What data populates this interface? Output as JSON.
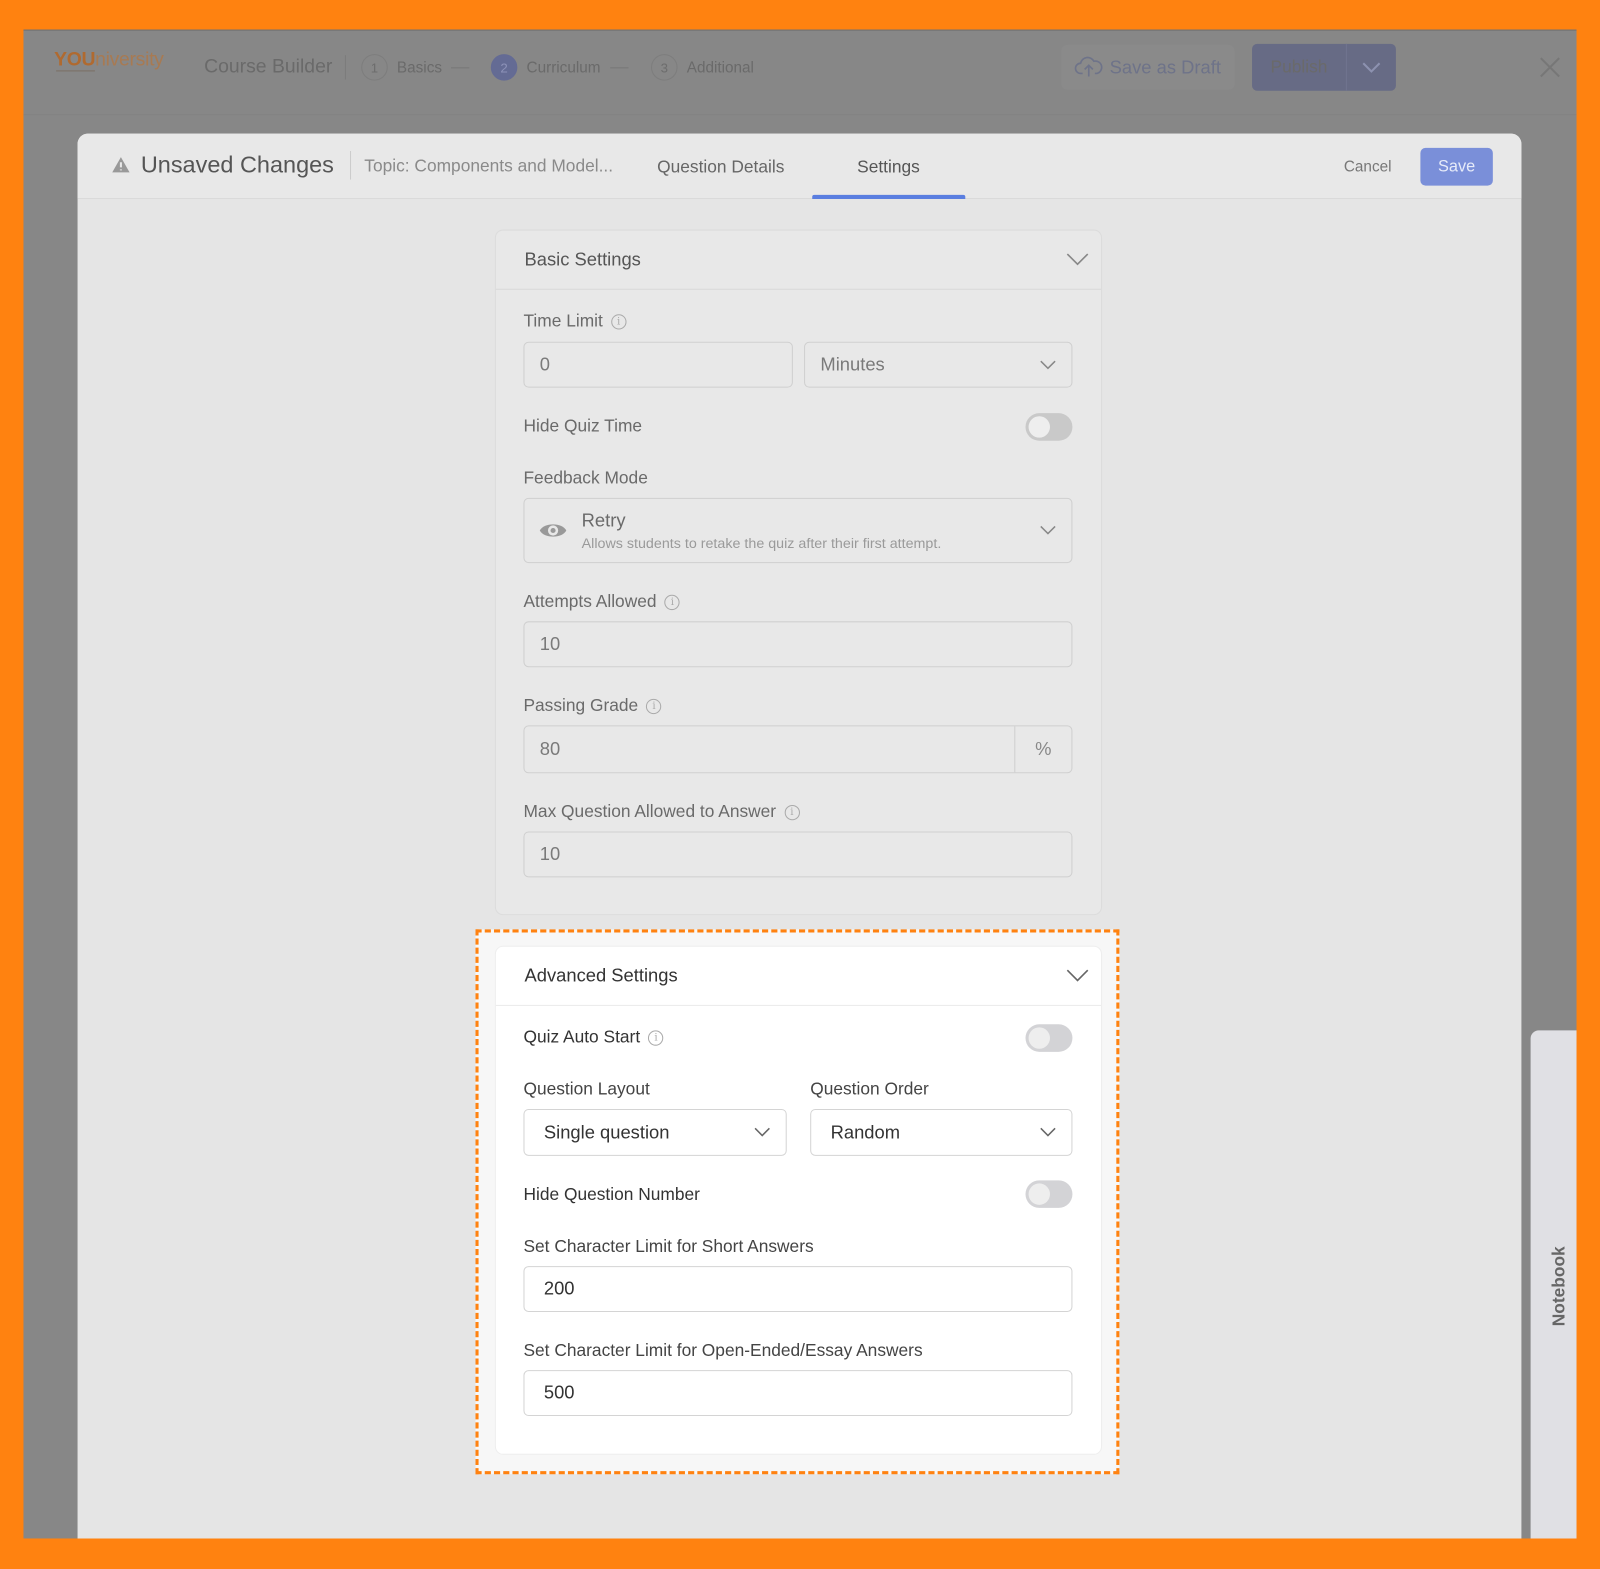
{
  "topbar": {
    "logo": "YOUniversity",
    "logo_bold": "YOU",
    "logo_rest": "niversity",
    "title": "Course Builder",
    "steps": [
      {
        "num": "1",
        "label": "Basics"
      },
      {
        "num": "2",
        "label": "Curriculum",
        "active": true
      },
      {
        "num": "3",
        "label": "Additional"
      }
    ],
    "save_draft": "Save as Draft",
    "publish": "Publish"
  },
  "modal": {
    "status": "Unsaved Changes",
    "topic": "Topic: Components and Model...",
    "tabs": [
      {
        "label": "Question Details"
      },
      {
        "label": "Settings",
        "active": true
      }
    ],
    "cancel": "Cancel",
    "save": "Save"
  },
  "basic": {
    "title": "Basic Settings",
    "time_limit_label": "Time Limit",
    "time_limit_value": "0",
    "time_unit": "Minutes",
    "hide_quiz_time": "Hide Quiz Time",
    "hide_quiz_time_on": false,
    "feedback_label": "Feedback Mode",
    "feedback_value": "Retry",
    "feedback_desc": "Allows students to retake the quiz after their first attempt.",
    "attempts_label": "Attempts Allowed",
    "attempts_value": "10",
    "passing_label": "Passing Grade",
    "passing_value": "80",
    "passing_unit": "%",
    "max_label": "Max Question Allowed to Answer",
    "max_value": "10"
  },
  "advanced": {
    "title": "Advanced Settings",
    "auto_start": "Quiz Auto Start",
    "auto_start_on": false,
    "layout_label": "Question Layout",
    "layout_value": "Single question",
    "order_label": "Question Order",
    "order_value": "Random",
    "hide_number": "Hide Question Number",
    "hide_number_on": false,
    "short_label": "Set Character Limit for Short Answers",
    "short_value": "200",
    "essay_label": "Set Character Limit for Open-Ended/Essay Answers",
    "essay_value": "500"
  },
  "notebook": "Notebook",
  "colors": {
    "highlight": "#ff8210",
    "accent": "#5a7ee0"
  }
}
